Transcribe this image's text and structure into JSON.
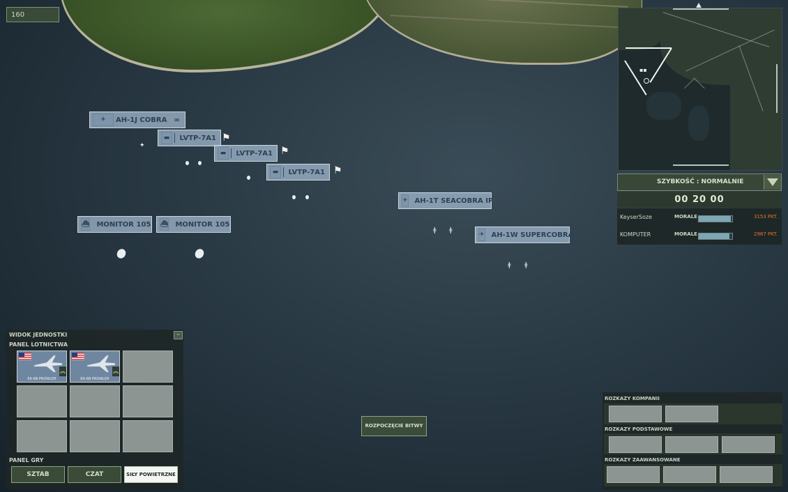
{
  "hud": {
    "counter": "160"
  },
  "units": [
    {
      "label": "AH-1J COBRA",
      "icon": "helicopter-icon"
    },
    {
      "label": "LVTP-7A1",
      "icon": "amphibious-vehicle-icon"
    },
    {
      "label": "LVTP-7A1",
      "icon": "amphibious-vehicle-icon"
    },
    {
      "label": "LVTP-7A1",
      "icon": "amphibious-vehicle-icon"
    },
    {
      "label": "AH-1T SEACOBRA IP",
      "icon": "helicopter-icon"
    },
    {
      "label": "AH-1W SUPERCOBRA",
      "icon": "helicopter-icon"
    },
    {
      "label": "MONITOR 105",
      "icon": "boat-icon"
    },
    {
      "label": "MONITOR 105",
      "icon": "boat-icon"
    }
  ],
  "speed": {
    "label": "SZYBKOŚĆ : NORMALNIE"
  },
  "timer": "00 20 00",
  "scores": [
    {
      "player": "KeyserSoze",
      "morale_label": "MORALE",
      "morale": 0.95,
      "points": "3153 PKT."
    },
    {
      "player": "KOMPUTER",
      "morale_label": "MORALE",
      "morale": 0.92,
      "points": "2987 PKT."
    }
  ],
  "unit_panel": {
    "title": "WIDOK JEDNOSTKI",
    "minimize": "–",
    "air_panel_title": "PANEL LOTNICTWA",
    "slots": [
      {
        "filled": true,
        "name": "EA-6B PROWLER",
        "rank": "︽"
      },
      {
        "filled": true,
        "name": "EA-6B PROWLER",
        "rank": "︽"
      },
      {
        "filled": false
      },
      {
        "filled": false
      },
      {
        "filled": false
      },
      {
        "filled": false
      },
      {
        "filled": false
      },
      {
        "filled": false
      },
      {
        "filled": false
      }
    ],
    "game_panel_title": "PANEL GRY",
    "buttons": [
      "SZTAB",
      "CZAT",
      "SIŁY POWIETRZNE"
    ]
  },
  "start_battle": "ROZPOCZĘCIE BITWY",
  "orders": {
    "company": "ROZKAZY KOMPANII",
    "basic": "ROZKAZY PODSTAWOWE",
    "advanced": "ROZKAZY ZAAWANSOWANE"
  }
}
